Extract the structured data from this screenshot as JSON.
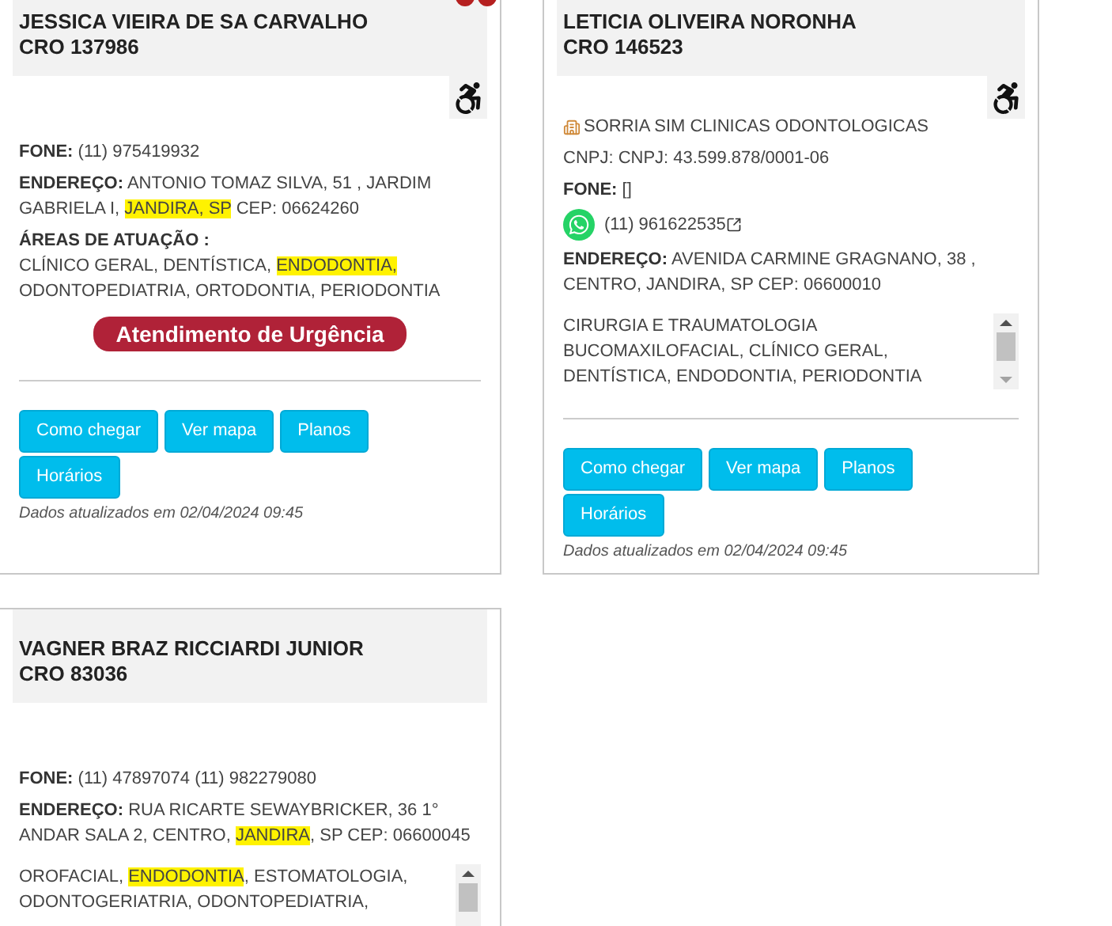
{
  "cards": [
    {
      "name": "JESSICA VIEIRA DE SA CARVALHO",
      "cro": "CRO 137986",
      "accessible": true,
      "top_mark": true,
      "phone_label": "FONE:",
      "phone": "(11) 975419932",
      "address_label": "ENDEREÇO:",
      "address": [
        {
          "text": "ANTONIO TOMAZ SILVA, 51 , JARDIM GABRIELA I, ",
          "highlight": false
        },
        {
          "text": "JANDIRA, SP",
          "highlight": true
        },
        {
          "text": " CEP: 06624260",
          "highlight": false
        }
      ],
      "areas_label": "ÁREAS DE ATUAÇÃO :",
      "areas_scroll": false,
      "areas": [
        {
          "text": "CLÍNICO GERAL, DENTÍSTICA, ",
          "highlight": false
        },
        {
          "text": "ENDODONTIA,",
          "highlight": true
        },
        {
          "text": " ODONTOPEDIATRIA, ORTODONTIA, PERIODONTIA",
          "highlight": false
        }
      ],
      "urgency": "Atendimento de Urgência",
      "buttons": [
        "Como chegar",
        "Ver mapa",
        "Planos",
        "Horários"
      ],
      "updated": "Dados atualizados em 02/04/2024 09:45"
    },
    {
      "name": "LETICIA OLIVEIRA NORONHA",
      "cro": "CRO 146523",
      "accessible": true,
      "top_mark": false,
      "clinic": "SORRIA SIM CLINICAS ODONTOLOGICAS",
      "cnpj": "CNPJ: CNPJ: 43.599.878/0001-06",
      "phone_label": "FONE:",
      "phone": "[]",
      "whatsapp": "(11) 961622535",
      "address_label": "ENDEREÇO:",
      "address": [
        {
          "text": "AVENIDA CARMINE GRAGNANO, 38 , CENTRO, JANDIRA, SP CEP: 06600010",
          "highlight": false
        }
      ],
      "areas_scroll": true,
      "areas": [
        {
          "text": "CIRURGIA E TRAUMATOLOGIA BUCOMAXILOFACIAL, CLÍNICO GERAL, DENTÍSTICA, ENDODONTIA, PERIODONTIA",
          "highlight": false
        }
      ],
      "buttons": [
        "Como chegar",
        "Ver mapa",
        "Planos",
        "Horários"
      ],
      "updated": "Dados atualizados em 02/04/2024 09:45"
    },
    {
      "name": "VAGNER BRAZ RICCIARDI JUNIOR",
      "cro": "CRO 83036",
      "accessible": false,
      "top_mark": false,
      "phone_label": "FONE:",
      "phone": "(11) 47897074 (11) 982279080",
      "address_label": "ENDEREÇO:",
      "address": [
        {
          "text": "RUA RICARTE SEWAYBRICKER, 36 1° ANDAR SALA 2, CENTRO, ",
          "highlight": false
        },
        {
          "text": "JANDIRA",
          "highlight": true
        },
        {
          "text": ", SP CEP: 06600045",
          "highlight": false
        }
      ],
      "areas_scroll": true,
      "areas": [
        {
          "text": "OROFACIAL, ",
          "highlight": false
        },
        {
          "text": "ENDODONTIA",
          "highlight": true
        },
        {
          "text": ", ESTOMATOLOGIA, ODONTOGERIATRIA, ODONTOPEDIATRIA,",
          "highlight": false
        }
      ]
    }
  ]
}
